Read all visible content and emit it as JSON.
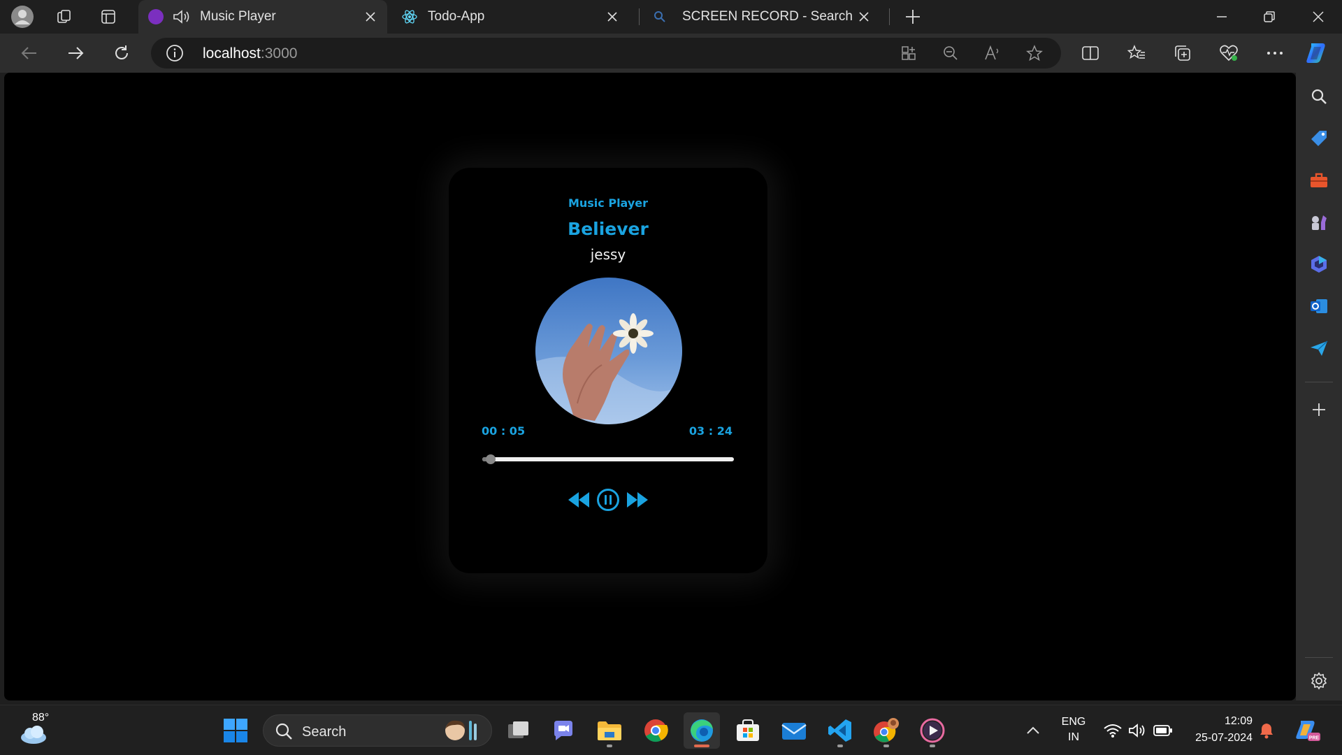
{
  "browser": {
    "tabs": [
      {
        "title": "Music Player",
        "active": true
      },
      {
        "title": "Todo-App",
        "active": false
      },
      {
        "title": "SCREEN RECORD - Search",
        "active": false
      }
    ],
    "url": {
      "host": "localhost",
      "port": ":3000"
    }
  },
  "player": {
    "label": "Music Player",
    "song_title": "Believer",
    "artist": "jessy",
    "current_time": "00 : 05",
    "total_time": "03 : 24",
    "progress": 0.025,
    "state": "playing"
  },
  "taskbar": {
    "weather_temp": "88°",
    "search_label": "Search",
    "language_top": "ENG",
    "language_bottom": "IN",
    "time": "12:09",
    "date": "25-07-2024"
  },
  "colors": {
    "accent": "#1aa3e0",
    "background": "#000000",
    "chrome": "#2d2d2d"
  }
}
